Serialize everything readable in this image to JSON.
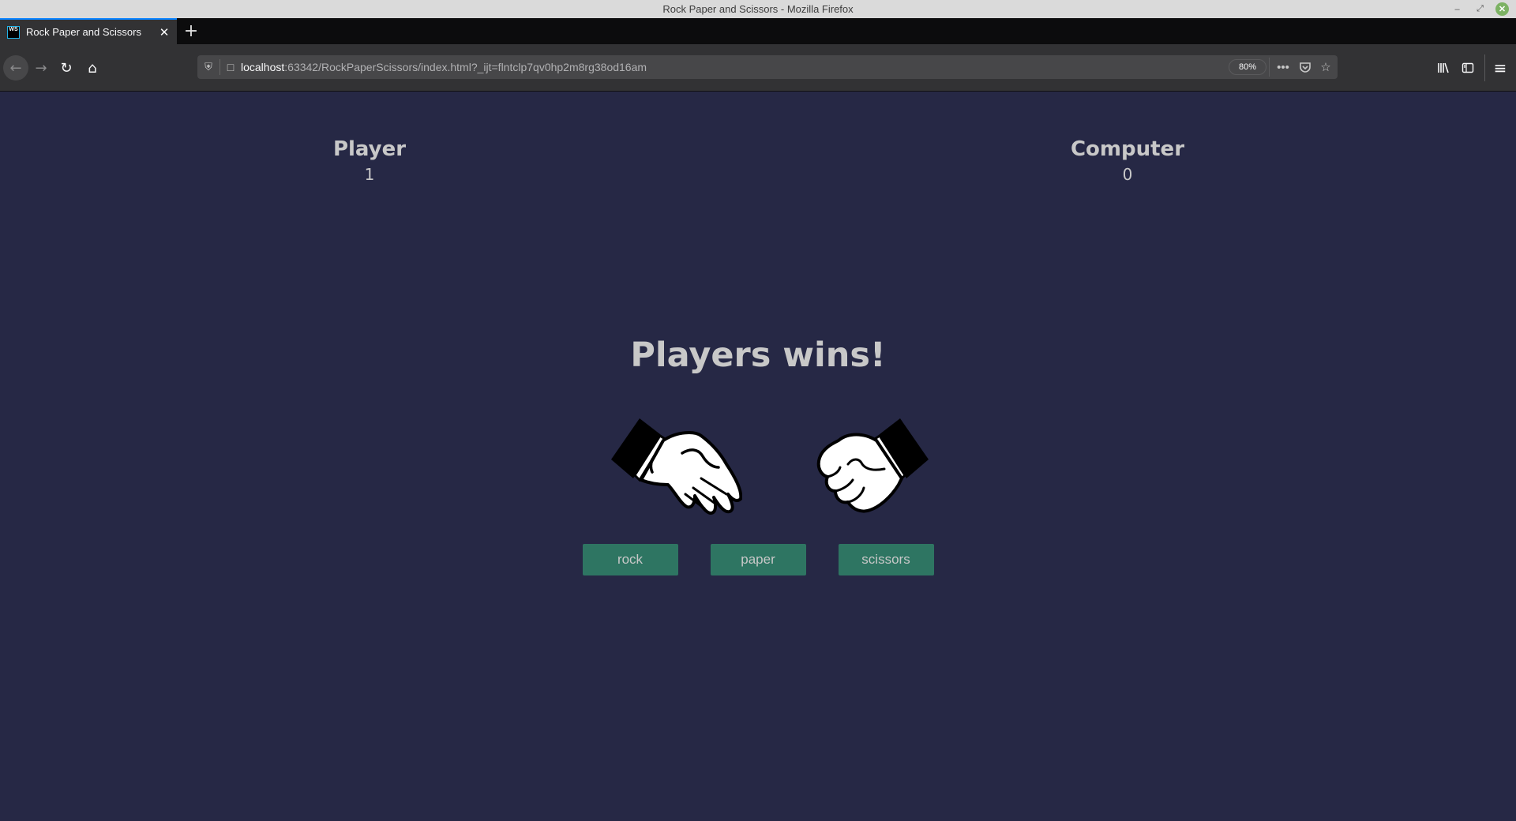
{
  "window": {
    "title": "Rock Paper and Scissors - Mozilla Firefox",
    "controls": {
      "minimize": "–",
      "maximize": "⤢",
      "close": "✕"
    }
  },
  "tabs": [
    {
      "title": "Rock Paper and Scissors",
      "favicon": "WS",
      "active": true
    }
  ],
  "tab_close_glyph": "✕",
  "new_tab_glyph": "+",
  "nav": {
    "back_glyph": "←",
    "forward_glyph": "→",
    "reload_glyph": "↻",
    "home_glyph": "⌂"
  },
  "urlbar": {
    "host": "localhost",
    "rest": ":63342/RockPaperScissors/index.html?_ijt=flntclp7qv0hp2m8rg38od16am",
    "zoom": "80%",
    "more_glyph": "•••",
    "pocket_glyph": "⌵",
    "star_glyph": "☆",
    "shield_glyph": "⛨",
    "page_glyph": "□"
  },
  "toolbar": {
    "library_glyph": "Ⅱ\\",
    "sidebar_glyph": "◫",
    "menu_glyph": "≡"
  },
  "game": {
    "player": {
      "label": "Player",
      "score": "1",
      "hand": "paper"
    },
    "computer": {
      "label": "Computer",
      "score": "0",
      "hand": "rock"
    },
    "result": "Players wins!",
    "choices": [
      "rock",
      "paper",
      "scissors"
    ]
  },
  "colors": {
    "background": "#262845",
    "text": "#c8c8c8",
    "button": "#2e7562"
  }
}
